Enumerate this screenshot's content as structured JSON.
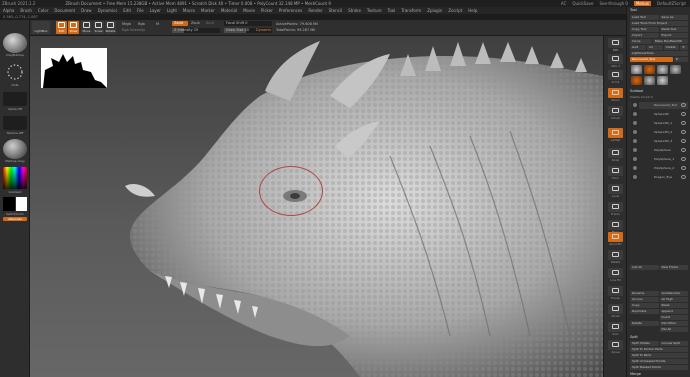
{
  "titlebar": {
    "app_title": "ZBrush 2021.1.2",
    "status_info": "ZBrush Document  •  Free Mem 15.238GB  •  Active Mem 4891  •  Scratch Disk 40  •  Timer 0.008  •  PolyCount 32.148 MP  •  MeshCount 9",
    "ac_label": "AC",
    "quicksave_label": "QuickSave",
    "see_through_label": "See-through 0",
    "menus_label": "Menus",
    "script_label": "DefaultZScript"
  },
  "menu": {
    "items": [
      "Alpha",
      "Brush",
      "Color",
      "Document",
      "Draw",
      "Dynamics",
      "Edit",
      "File",
      "Layer",
      "Light",
      "Macro",
      "Marker",
      "Material",
      "Movie",
      "Picker",
      "Preferences",
      "Render",
      "Stencil",
      "Stroke",
      "Texture",
      "Tool",
      "Transform",
      "Zplugin",
      "Zscript",
      "Help"
    ]
  },
  "infobar": {
    "text": "0.365,-0.774,-1.067"
  },
  "toolbar": {
    "lightbox": "LightBox",
    "edit": "Edit",
    "draw": "Draw",
    "move": "Move",
    "scale": "Scale",
    "rotate": "Rotate",
    "mrgb": "Mrgb",
    "rgb": "Rgb",
    "m": "M",
    "rgb_intensity": "Rgb Intensity",
    "zadd": "Zadd",
    "zsub": "Zsub",
    "zcut": "Zcut",
    "z_intensity": "Z Intensity 25",
    "focal_shift": "Focal Shift 0",
    "draw_size": "Draw Size 45",
    "dynamic": "Dynamic",
    "active_points": "ActivePoints: 79.608 Mil",
    "total_points": "TotalPoints: 99.287 Mil",
    "z_intensity_level": 0.25,
    "draw_size_level": 0.45
  },
  "left_shelf": {
    "brush_label": "ClayBuildup",
    "stroke_label": "Dots",
    "alpha_label": "Alpha Off",
    "texture_label": "Texture Off",
    "material_label": "MatCap Gray",
    "gradient_label": "Gradient",
    "switch_color_label": "SwitchColor",
    "alternate_label": "Alternate",
    "main_color": "#ffffff",
    "secondary_color": "#000000"
  },
  "right_shelf": {
    "labels": [
      "BPR",
      "SPix 3",
      "Scroll",
      "Zoom",
      "Actual",
      "AAHalf",
      "Persp",
      "Floor",
      "Local",
      "Frame",
      "Move",
      "Zoom3D",
      "Rotate",
      "Line Fill",
      "Transp",
      "Ghost",
      "Solo",
      "Xpose"
    ]
  },
  "tray": {
    "tool_title": "Tool",
    "load_tool": "Load Tool",
    "save_as": "Save As",
    "load_tools_project": "Load Tools From Project",
    "copy_tool": "Copy Tool",
    "paste_tool": "Paste Tool",
    "import": "Import",
    "export": "Export",
    "clone": "Clone",
    "make_polymesh": "Make PolyMesh3D",
    "goz": "GoZ",
    "all": "All",
    "visible": "Visible",
    "r": "R",
    "lightbox_tools": "Lightbox▸Tools",
    "current_tool": "Recovered_Tool",
    "r_value": "R",
    "subtool_title": "Subtool",
    "visible_count": "Visible Count 9",
    "subtools": [
      "Recovered_Tool",
      "Sphere3D",
      "Sphere3D_1",
      "Sphere3D_2",
      "Sphere3D_3",
      "PolySphere",
      "PolySphere_1",
      "PolySphere_2",
      "Dragon_Eye"
    ],
    "list_all": "List All",
    "new_folder": "New Folder",
    "rename": "Rename",
    "autoreorder": "AutoReorder",
    "all_low": "All Low",
    "all_high": "All High",
    "copy": "Copy",
    "paste": "Paste",
    "duplicate": "Duplicate",
    "append": "Append",
    "insert": "Insert",
    "delete": "Delete",
    "del_other": "Del Other",
    "del_all": "Del All",
    "split_title": "Split",
    "split_hidden": "Split Hidden",
    "groups_split": "Groups Split",
    "split_similar": "Split To Similar Parts",
    "split_parts": "Split To Parts",
    "split_unmasked": "Split Unmasked Points",
    "split_masked": "Split Masked Points",
    "merge_title": "Merge"
  }
}
